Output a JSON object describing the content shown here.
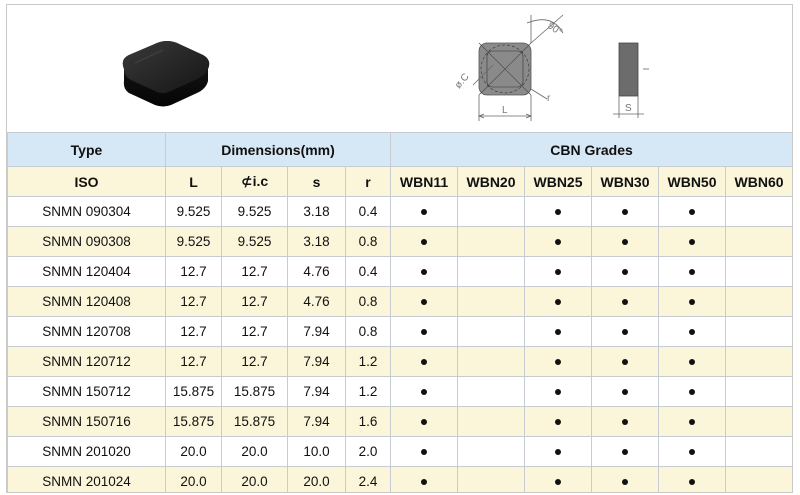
{
  "diagram": {
    "angle_label": "90°",
    "ic_label": "ø.C",
    "r_label": "r",
    "l_label": "L",
    "s_label": "S"
  },
  "table": {
    "group_headers": {
      "type": "Type",
      "dimensions": "Dimensions(mm)",
      "grades": "CBN Grades"
    },
    "columns": [
      "ISO",
      "L",
      "i.c",
      "s",
      "r",
      "WBN11",
      "WBN20",
      "WBN25",
      "WBN30",
      "WBN50",
      "WBN60"
    ],
    "ic_symbol": "⊄",
    "rows": [
      {
        "iso": "SNMN 090304",
        "L": "9.525",
        "ic": "9.525",
        "s": "3.18",
        "r": "0.4",
        "grades": [
          true,
          false,
          true,
          true,
          true,
          false
        ]
      },
      {
        "iso": "SNMN 090308",
        "L": "9.525",
        "ic": "9.525",
        "s": "3.18",
        "r": "0.8",
        "grades": [
          true,
          false,
          true,
          true,
          true,
          false
        ]
      },
      {
        "iso": "SNMN 120404",
        "L": "12.7",
        "ic": "12.7",
        "s": "4.76",
        "r": "0.4",
        "grades": [
          true,
          false,
          true,
          true,
          true,
          false
        ]
      },
      {
        "iso": "SNMN 120408",
        "L": "12.7",
        "ic": "12.7",
        "s": "4.76",
        "r": "0.8",
        "grades": [
          true,
          false,
          true,
          true,
          true,
          false
        ]
      },
      {
        "iso": "SNMN 120708",
        "L": "12.7",
        "ic": "12.7",
        "s": "7.94",
        "r": "0.8",
        "grades": [
          true,
          false,
          true,
          true,
          true,
          false
        ]
      },
      {
        "iso": "SNMN 120712",
        "L": "12.7",
        "ic": "12.7",
        "s": "7.94",
        "r": "1.2",
        "grades": [
          true,
          false,
          true,
          true,
          true,
          false
        ]
      },
      {
        "iso": "SNMN 150712",
        "L": "15.875",
        "ic": "15.875",
        "s": "7.94",
        "r": "1.2",
        "grades": [
          true,
          false,
          true,
          true,
          true,
          false
        ]
      },
      {
        "iso": "SNMN 150716",
        "L": "15.875",
        "ic": "15.875",
        "s": "7.94",
        "r": "1.6",
        "grades": [
          true,
          false,
          true,
          true,
          true,
          false
        ]
      },
      {
        "iso": "SNMN 201020",
        "L": "20.0",
        "ic": "20.0",
        "s": "10.0",
        "r": "2.0",
        "grades": [
          true,
          false,
          true,
          true,
          true,
          false
        ]
      },
      {
        "iso": "SNMN 201024",
        "L": "20.0",
        "ic": "20.0",
        "s": "20.0",
        "r": "2.4",
        "grades": [
          true,
          false,
          true,
          true,
          true,
          false
        ]
      }
    ]
  },
  "colors": {
    "header_blue": "#d6e8f5",
    "row_cream": "#fbf5d9",
    "border": "#c7ccd3"
  }
}
